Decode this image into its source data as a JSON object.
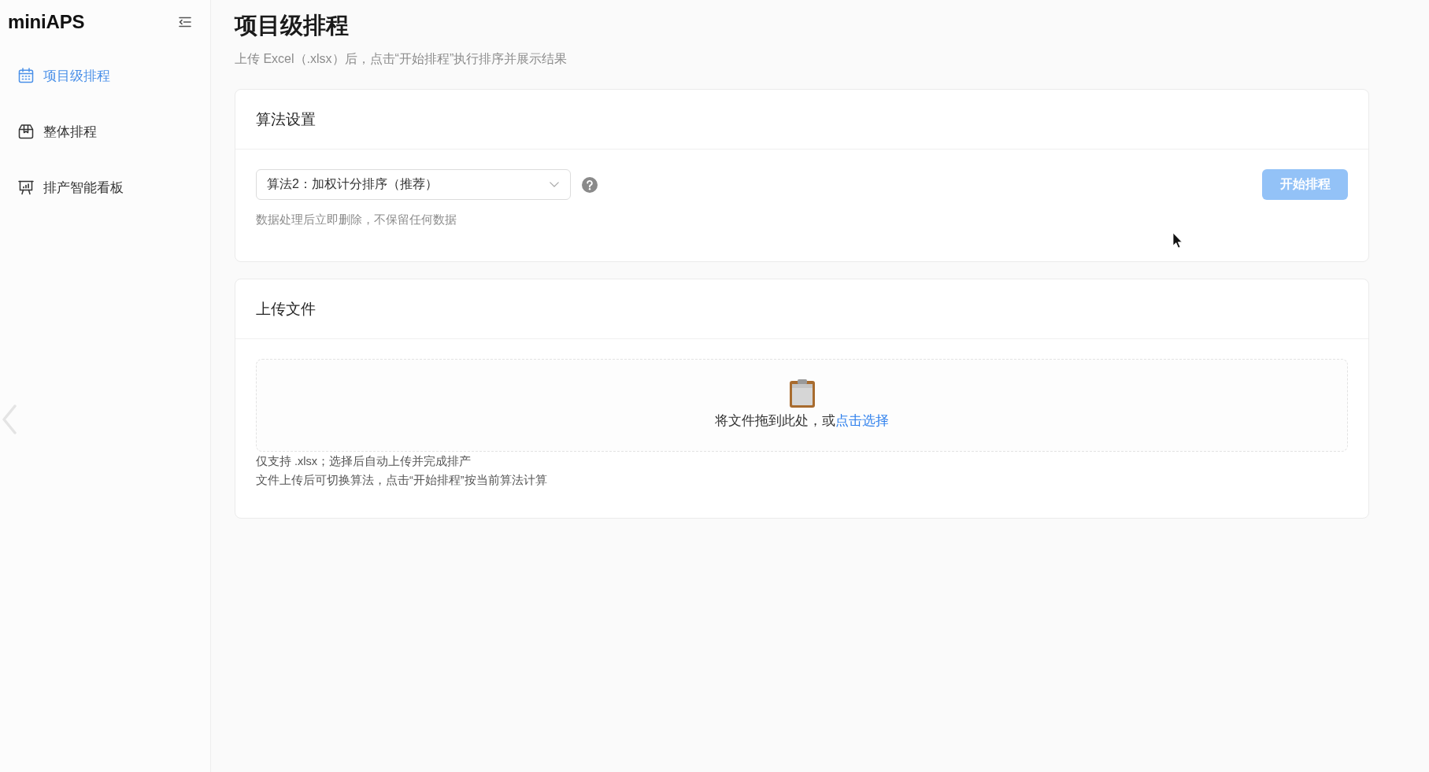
{
  "sidebar": {
    "logo": "miniAPS",
    "items": [
      {
        "label": "项目级排程",
        "selected": true
      },
      {
        "label": "整体排程",
        "selected": false
      },
      {
        "label": "排产智能看板",
        "selected": false
      }
    ]
  },
  "page": {
    "title": "项目级排程",
    "subtitle": "上传 Excel（.xlsx）后，点击“开始排程”执行排序并展示结果"
  },
  "algorithm_card": {
    "title": "算法设置",
    "select": {
      "value": "算法2：加权计分排序（推荐）"
    },
    "hint": "数据处理后立即删除，不保留任何数据",
    "start_button": {
      "label": "开始排程",
      "disabled": true
    }
  },
  "upload_card": {
    "title": "上传文件",
    "dropzone": {
      "text": "将文件拖到此处，或",
      "link": "点击选择"
    },
    "notes": [
      "仅支持 .xlsx；选择后自动上传并完成排产",
      "文件上传后可切换算法，点击“开始排程”按当前算法计算"
    ]
  }
}
